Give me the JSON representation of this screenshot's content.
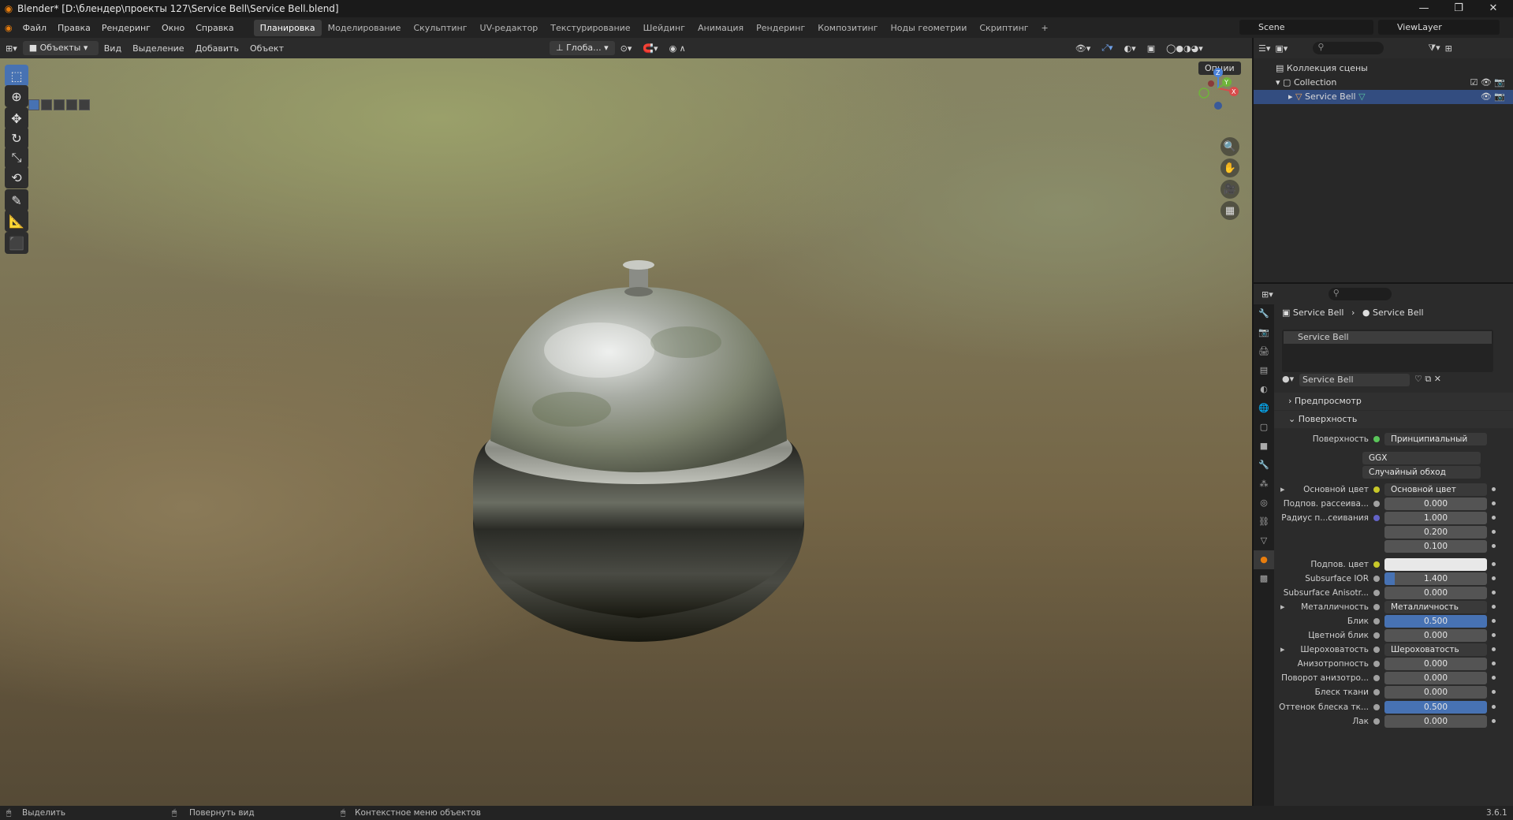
{
  "window": {
    "title": "Blender* [D:\\блендер\\проекты 127\\Service Bell\\Service Bell.blend]",
    "minimize": "—",
    "maximize": "❐",
    "close": "✕"
  },
  "menu": [
    "Файл",
    "Правка",
    "Рендеринг",
    "Окно",
    "Справка"
  ],
  "workspaces": [
    "Планировка",
    "Моделирование",
    "Скульптинг",
    "UV-редактор",
    "Текстурирование",
    "Шейдинг",
    "Анимация",
    "Рендеринг",
    "Композитинг",
    "Ноды геометрии",
    "Скриптинг"
  ],
  "active_workspace": "Планировка",
  "scene": "Scene",
  "view_layer": "ViewLayer",
  "viewport_header": {
    "mode": "Объекты",
    "menus": [
      "Вид",
      "Выделение",
      "Добавить",
      "Объект"
    ],
    "orientation": "Глоба...",
    "options": "Опции"
  },
  "tools": [
    "select",
    "cursor",
    "move",
    "rotate",
    "scale",
    "transform",
    "annotate",
    "measure",
    "add-cube"
  ],
  "outliner": {
    "scene_collection": "Коллекция сцены",
    "collection": "Collection",
    "object": "Service Bell"
  },
  "properties": {
    "breadcrumb_object": "Service Bell",
    "breadcrumb_material": "Service Bell",
    "material_slot": "Service Bell",
    "material_name": "Service Bell",
    "panel_preview": "Предпросмотр",
    "panel_surface": "Поверхность",
    "surface_label": "Поверхность",
    "surface_value": "Принципиальный BSDF",
    "distribution": "GGX",
    "subsurface_method": "Случайный обход",
    "rows": [
      {
        "label": "Основной цвет",
        "value": "Основной цвет",
        "kind": "link",
        "dot": "#c7c729",
        "expand": true
      },
      {
        "label": "Подпов. рассеива...",
        "value": "0.000",
        "kind": "num",
        "dot": "#a1a1a1"
      },
      {
        "label": "Радиус п...сеивания",
        "value": "1.000",
        "kind": "num",
        "dot": "#6363c7"
      },
      {
        "label": "",
        "value": "0.200",
        "kind": "num",
        "dot": ""
      },
      {
        "label": "",
        "value": "0.100",
        "kind": "num",
        "dot": ""
      },
      {
        "label": "Подпов. цвет",
        "value": "",
        "kind": "color",
        "dot": "#c7c729"
      },
      {
        "label": "Subsurface IOR",
        "value": "1.400",
        "kind": "partial",
        "dot": "#a1a1a1",
        "fill": 0.1
      },
      {
        "label": "Subsurface Anisotr...",
        "value": "0.000",
        "kind": "num",
        "dot": "#a1a1a1"
      },
      {
        "label": "Металличность",
        "value": "Металличность",
        "kind": "link",
        "dot": "#a1a1a1",
        "expand": true
      },
      {
        "label": "Блик",
        "value": "0.500",
        "kind": "fill",
        "dot": "#a1a1a1"
      },
      {
        "label": "Цветной блик",
        "value": "0.000",
        "kind": "num",
        "dot": "#a1a1a1"
      },
      {
        "label": "Шероховатость",
        "value": "Шероховатость",
        "kind": "link",
        "dot": "#a1a1a1",
        "expand": true
      },
      {
        "label": "Анизотропность",
        "value": "0.000",
        "kind": "num",
        "dot": "#a1a1a1"
      },
      {
        "label": "Поворот анизотро...",
        "value": "0.000",
        "kind": "num",
        "dot": "#a1a1a1"
      },
      {
        "label": "Блеск ткани",
        "value": "0.000",
        "kind": "num",
        "dot": "#a1a1a1"
      },
      {
        "label": "Оттенок блеска тк...",
        "value": "0.500",
        "kind": "fill",
        "dot": "#a1a1a1"
      },
      {
        "label": "Лак",
        "value": "0.000",
        "kind": "num",
        "dot": "#a1a1a1"
      }
    ]
  },
  "status": {
    "select": "Выделить",
    "rotate": "Повернуть вид",
    "context": "Контекстное меню объектов",
    "version": "3.6.1"
  },
  "colors": {
    "accent": "#4772b3",
    "selection": "#334d80",
    "orange": "#e87d0d"
  }
}
